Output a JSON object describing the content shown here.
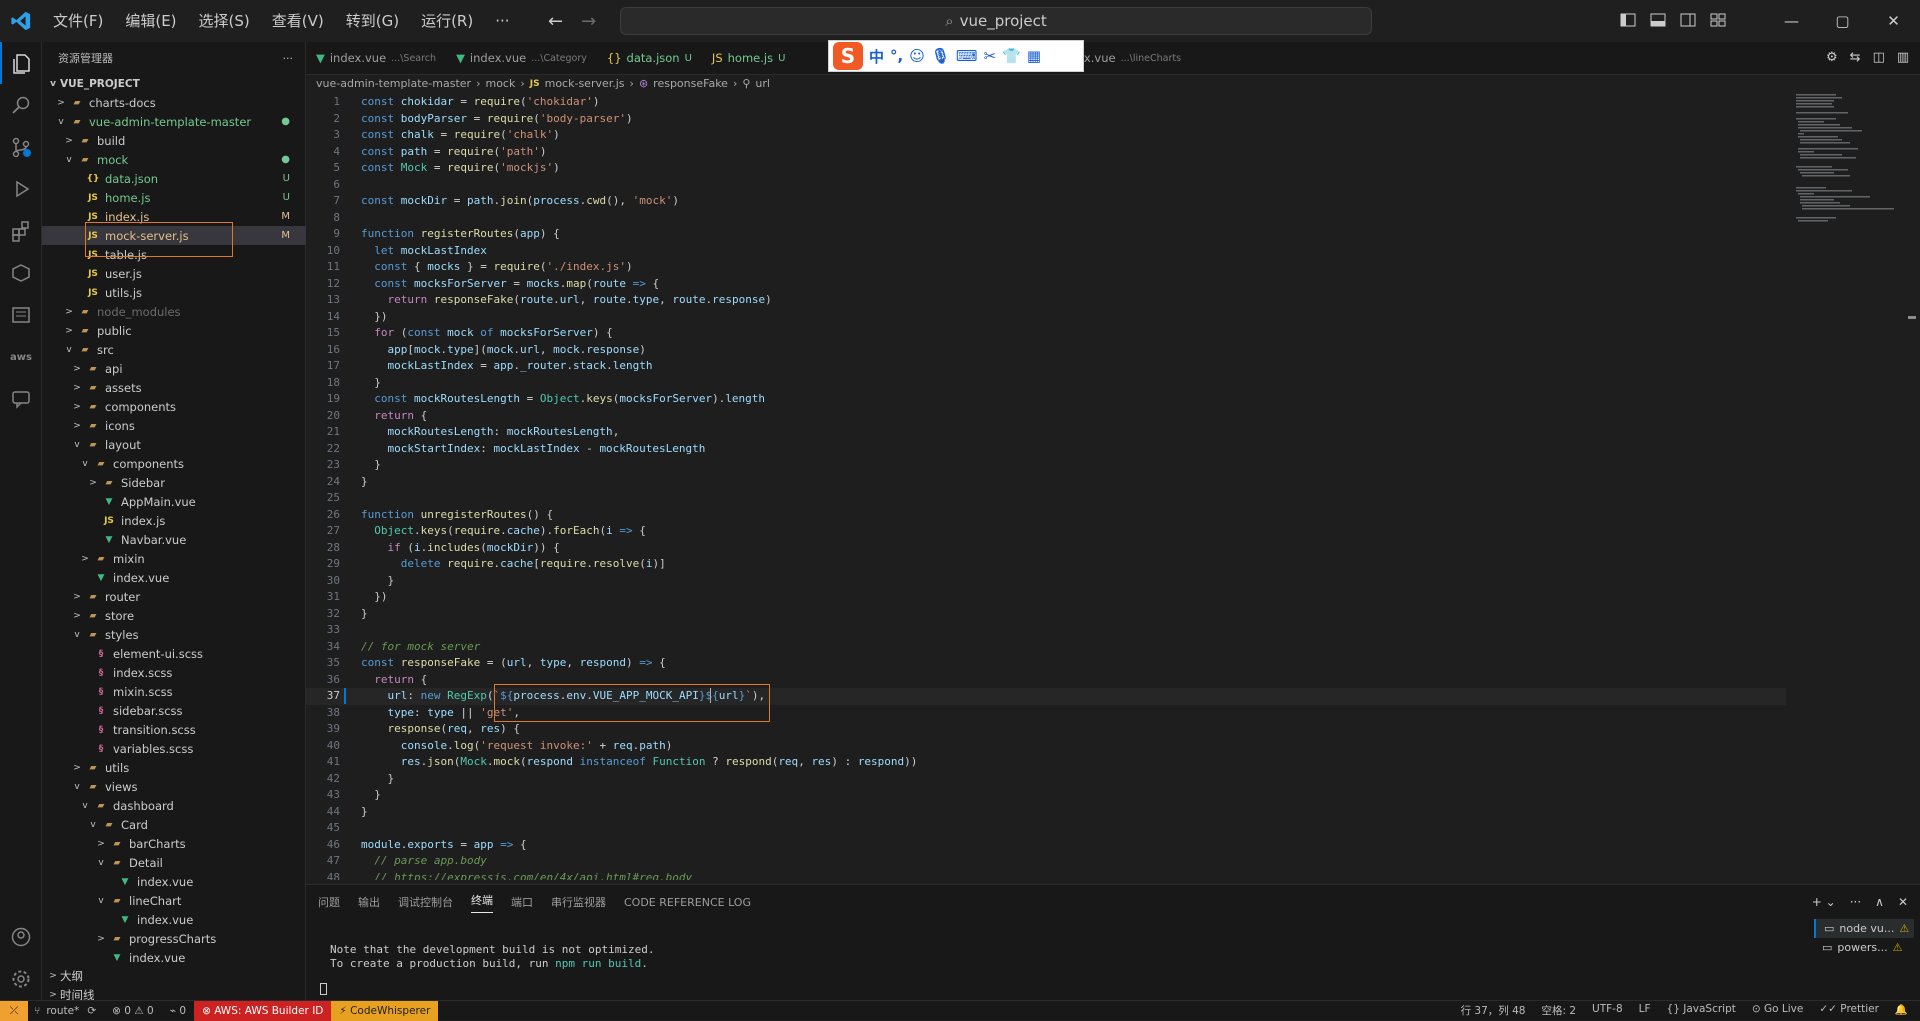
{
  "menu": [
    "文件(F)",
    "编辑(E)",
    "选择(S)",
    "查看(V)",
    "转到(G)",
    "运行(R)",
    "···"
  ],
  "search": {
    "text": "vue_project"
  },
  "window": {
    "minimize": "—",
    "maximize": "▢",
    "close": "✕"
  },
  "sidebar": {
    "title": "资源管理器",
    "more": "···",
    "root": "VUE_PROJECT",
    "bottom": [
      "大纲",
      "时间线"
    ]
  },
  "tree": [
    {
      "depth": 1,
      "chev": ">",
      "icon": "folder",
      "label": "charts-docs"
    },
    {
      "depth": 1,
      "chev": "v",
      "icon": "folder",
      "label": "vue-admin-template-master",
      "badge": "●",
      "badgeColor": "#73c991",
      "color": "#73c991"
    },
    {
      "depth": 2,
      "chev": ">",
      "icon": "folder",
      "label": "build"
    },
    {
      "depth": 2,
      "chev": "v",
      "icon": "folder",
      "label": "mock",
      "badge": "●",
      "badgeColor": "#73c991",
      "color": "#73c991"
    },
    {
      "depth": 3,
      "chev": "",
      "icon": "json",
      "label": "data.json",
      "badge": "U",
      "badgeColor": "#73c991",
      "color": "#73c991"
    },
    {
      "depth": 3,
      "chev": "",
      "icon": "js",
      "label": "home.js",
      "badge": "U",
      "badgeColor": "#73c991",
      "color": "#73c991"
    },
    {
      "depth": 3,
      "chev": "",
      "icon": "js",
      "label": "index.js",
      "badge": "M",
      "badgeColor": "#e2c08d",
      "color": "#e2c08d"
    },
    {
      "depth": 3,
      "chev": "",
      "icon": "js",
      "label": "mock-server.js",
      "badge": "M",
      "badgeColor": "#e2c08d",
      "color": "#e2c08d",
      "selected": true
    },
    {
      "depth": 3,
      "chev": "",
      "icon": "js",
      "label": "table.js"
    },
    {
      "depth": 3,
      "chev": "",
      "icon": "js",
      "label": "user.js"
    },
    {
      "depth": 3,
      "chev": "",
      "icon": "js",
      "label": "utils.js"
    },
    {
      "depth": 2,
      "chev": ">",
      "icon": "folder",
      "label": "node_modules",
      "color": "#6b6b6b"
    },
    {
      "depth": 2,
      "chev": ">",
      "icon": "folder",
      "label": "public"
    },
    {
      "depth": 2,
      "chev": "v",
      "icon": "folder",
      "label": "src"
    },
    {
      "depth": 3,
      "chev": ">",
      "icon": "folder",
      "label": "api"
    },
    {
      "depth": 3,
      "chev": ">",
      "icon": "folder",
      "label": "assets"
    },
    {
      "depth": 3,
      "chev": ">",
      "icon": "folder",
      "label": "components"
    },
    {
      "depth": 3,
      "chev": ">",
      "icon": "folder",
      "label": "icons"
    },
    {
      "depth": 3,
      "chev": "v",
      "icon": "folder",
      "label": "layout"
    },
    {
      "depth": 4,
      "chev": "v",
      "icon": "folder",
      "label": "components"
    },
    {
      "depth": 5,
      "chev": ">",
      "icon": "folder",
      "label": "Sidebar"
    },
    {
      "depth": 5,
      "chev": "",
      "icon": "vue",
      "label": "AppMain.vue"
    },
    {
      "depth": 5,
      "chev": "",
      "icon": "js",
      "label": "index.js"
    },
    {
      "depth": 5,
      "chev": "",
      "icon": "vue",
      "label": "Navbar.vue"
    },
    {
      "depth": 4,
      "chev": ">",
      "icon": "folder",
      "label": "mixin"
    },
    {
      "depth": 4,
      "chev": "",
      "icon": "vue",
      "label": "index.vue"
    },
    {
      "depth": 3,
      "chev": ">",
      "icon": "folder",
      "label": "router"
    },
    {
      "depth": 3,
      "chev": ">",
      "icon": "folder",
      "label": "store"
    },
    {
      "depth": 3,
      "chev": "v",
      "icon": "folder",
      "label": "styles"
    },
    {
      "depth": 4,
      "chev": "",
      "icon": "scss",
      "label": "element-ui.scss"
    },
    {
      "depth": 4,
      "chev": "",
      "icon": "scss",
      "label": "index.scss"
    },
    {
      "depth": 4,
      "chev": "",
      "icon": "scss",
      "label": "mixin.scss"
    },
    {
      "depth": 4,
      "chev": "",
      "icon": "scss",
      "label": "sidebar.scss"
    },
    {
      "depth": 4,
      "chev": "",
      "icon": "scss",
      "label": "transition.scss"
    },
    {
      "depth": 4,
      "chev": "",
      "icon": "scss",
      "label": "variables.scss"
    },
    {
      "depth": 3,
      "chev": ">",
      "icon": "folder",
      "label": "utils"
    },
    {
      "depth": 3,
      "chev": "v",
      "icon": "folder",
      "label": "views"
    },
    {
      "depth": 4,
      "chev": "v",
      "icon": "folder",
      "label": "dashboard"
    },
    {
      "depth": 5,
      "chev": "v",
      "icon": "folder",
      "label": "Card"
    },
    {
      "depth": 6,
      "chev": ">",
      "icon": "folder",
      "label": "barCharts"
    },
    {
      "depth": 6,
      "chev": "v",
      "icon": "folder",
      "label": "Detail"
    },
    {
      "depth": 7,
      "chev": "",
      "icon": "vue",
      "label": "index.vue"
    },
    {
      "depth": 6,
      "chev": "v",
      "icon": "folder",
      "label": "lineChart"
    },
    {
      "depth": 7,
      "chev": "",
      "icon": "vue",
      "label": "index.vue"
    },
    {
      "depth": 6,
      "chev": ">",
      "icon": "folder",
      "label": "progressCharts"
    },
    {
      "depth": 6,
      "chev": "",
      "icon": "vue",
      "label": "index.vue"
    }
  ],
  "tabs": [
    {
      "icon": "vue",
      "label": "index.vue",
      "desc": "...\\Search"
    },
    {
      "icon": "vue",
      "label": "index.vue",
      "desc": "...\\Category"
    },
    {
      "icon": "json",
      "label": "data.json",
      "u": "U"
    },
    {
      "icon": "js",
      "label": "home.js",
      "u": "U"
    },
    {
      "icon": "vue",
      "label": "index.vue",
      "desc": "...\\lineCharts"
    }
  ],
  "breadcrumb": [
    "vue-admin-template-master",
    "mock",
    "mock-server.js",
    "responseFake",
    "url"
  ],
  "code": [
    "<span class='k'>const</span> <span class='v'>chokidar</span> <span class='o'>=</span> <span class='f'>require</span>(<span class='s'>'chokidar'</span>)",
    "<span class='k'>const</span> <span class='v'>bodyParser</span> <span class='o'>=</span> <span class='f'>require</span>(<span class='s'>'body-parser'</span>)",
    "<span class='k'>const</span> <span class='v'>chalk</span> <span class='o'>=</span> <span class='f'>require</span>(<span class='s'>'chalk'</span>)",
    "<span class='k'>const</span> <span class='v'>path</span> <span class='o'>=</span> <span class='f'>require</span>(<span class='s'>'path'</span>)",
    "<span class='k'>const</span> <span class='t'>Mock</span> <span class='o'>=</span> <span class='f'>require</span>(<span class='s'>'mockjs'</span>)",
    "",
    "<span class='k'>const</span> <span class='v'>mockDir</span> <span class='o'>=</span> <span class='v'>path</span>.<span class='f'>join</span>(<span class='v'>process</span>.<span class='f'>cwd</span>(), <span class='s'>'mock'</span>)",
    "",
    "<span class='k'>function</span> <span class='f'>registerRoutes</span>(<span class='v'>app</span>) {",
    "  <span class='k'>let</span> <span class='v'>mockLastIndex</span>",
    "  <span class='k'>const</span> { <span class='v'>mocks</span> } <span class='o'>=</span> <span class='f'>require</span>(<span class='s'>'./index.js'</span>)",
    "  <span class='k'>const</span> <span class='v'>mocksForServer</span> <span class='o'>=</span> <span class='v'>mocks</span>.<span class='f'>map</span>(<span class='v'>route</span> <span class='k'>=></span> {",
    "    <span class='kc'>return</span> <span class='f'>responseFake</span>(<span class='v'>route</span>.<span class='v'>url</span>, <span class='v'>route</span>.<span class='v'>type</span>, <span class='v'>route</span>.<span class='v'>response</span>)",
    "  })",
    "  <span class='kc'>for</span> (<span class='k'>const</span> <span class='v'>mock</span> <span class='k'>of</span> <span class='v'>mocksForServer</span>) {",
    "    <span class='v'>app</span>[<span class='v'>mock</span>.<span class='v'>type</span>](<span class='v'>mock</span>.<span class='v'>url</span>, <span class='v'>mock</span>.<span class='v'>response</span>)",
    "    <span class='v'>mockLastIndex</span> <span class='o'>=</span> <span class='v'>app</span>.<span class='v'>_router</span>.<span class='v'>stack</span>.<span class='v'>length</span>",
    "  }",
    "  <span class='k'>const</span> <span class='v'>mockRoutesLength</span> <span class='o'>=</span> <span class='t'>Object</span>.<span class='f'>keys</span>(<span class='v'>mocksForServer</span>).<span class='v'>length</span>",
    "  <span class='kc'>return</span> {",
    "    <span class='v'>mockRoutesLength</span>: <span class='v'>mockRoutesLength</span>,",
    "    <span class='v'>mockStartIndex</span>: <span class='v'>mockLastIndex</span> <span class='o'>-</span> <span class='v'>mockRoutesLength</span>",
    "  }",
    "}",
    "",
    "<span class='k'>function</span> <span class='f'>unregisterRoutes</span>() {",
    "  <span class='t'>Object</span>.<span class='f'>keys</span>(<span class='f'>require</span>.<span class='v'>cache</span>).<span class='f'>forEach</span>(<span class='v'>i</span> <span class='k'>=></span> {",
    "    <span class='kc'>if</span> (<span class='v'>i</span>.<span class='f'>includes</span>(<span class='v'>mockDir</span>)) {",
    "      <span class='k'>delete</span> <span class='f'>require</span>.<span class='v'>cache</span>[<span class='f'>require</span>.<span class='f'>resolve</span>(<span class='v'>i</span>)]",
    "    }",
    "  })",
    "}",
    "",
    "<span class='c'>// for mock server</span>",
    "<span class='k'>const</span> <span class='f'>responseFake</span> <span class='o'>=</span> (<span class='v'>url</span>, <span class='v'>type</span>, <span class='v'>respond</span>) <span class='k'>=></span> {",
    "  <span class='kc'>return</span> {",
    "    <span class='v'>url</span>: <span class='k'>new</span> <span class='t'>RegExp</span>(<span class='s'>`</span><span class='k'>${</span><span class='v'>process</span>.<span class='v'>env</span>.<span class='v'>VUE_APP_MOCK_API</span><span class='k'>}${</span><span class='v'>url</span><span class='k'>}</span><span class='s'>`</span>),",
    "    <span class='v'>type</span>: <span class='v'>type</span> <span class='o'>||</span> <span class='s'>'get'</span>,",
    "    <span class='f'>response</span>(<span class='v'>req</span>, <span class='v'>res</span>) {",
    "      <span class='v'>console</span>.<span class='f'>log</span>(<span class='s'>'request invoke:'</span> <span class='o'>+</span> <span class='v'>req</span>.<span class='v'>path</span>)",
    "      <span class='v'>res</span>.<span class='f'>json</span>(<span class='t'>Mock</span>.<span class='f'>mock</span>(<span class='v'>respond</span> <span class='k'>instanceof</span> <span class='t'>Function</span> <span class='o'>?</span> <span class='f'>respond</span>(<span class='v'>req</span>, <span class='v'>res</span>) <span class='o'>:</span> <span class='v'>respond</span>))",
    "    }",
    "  }",
    "}",
    "",
    "<span class='v'>module</span>.<span class='v'>exports</span> <span class='o'>=</span> <span class='v'>app</span> <span class='k'>=></span> {",
    "  <span class='c'>// parse app.body</span>",
    "  <span class='c'>// <u>https://expressjs.com/en/4x/api.html#req.body</u></span>"
  ],
  "current_line": 37,
  "panel": {
    "tabs": [
      "问题",
      "输出",
      "调试控制台",
      "终端",
      "端口",
      "串行监视器",
      "CODE REFERENCE LOG"
    ],
    "active_tab": "终端",
    "terminal_lines": [
      "Note that the development build is not optimized.",
      "To create a production build, run <span style='color:#4ec9b0'>npm run build</span>."
    ],
    "terminals": [
      "node vu...",
      "powers..."
    ]
  },
  "status": {
    "branch": "route*",
    "sync": "⟳",
    "errors": "⊗ 0 ⚠ 0",
    "ports": "⌁ 0",
    "aws": "⊗ AWS: AWS Builder ID",
    "cw": "⚡ CodeWhisperer",
    "right": [
      "行 37，列 48",
      "空格: 2",
      "UTF-8",
      "LF",
      "{} JavaScript",
      "⊙ Go Live",
      "✓✓ Prettier"
    ]
  },
  "colors": {
    "accent": "#0078d4",
    "modified": "#e2c08d",
    "untracked": "#73c991",
    "highlight_box": "#e07a22"
  }
}
